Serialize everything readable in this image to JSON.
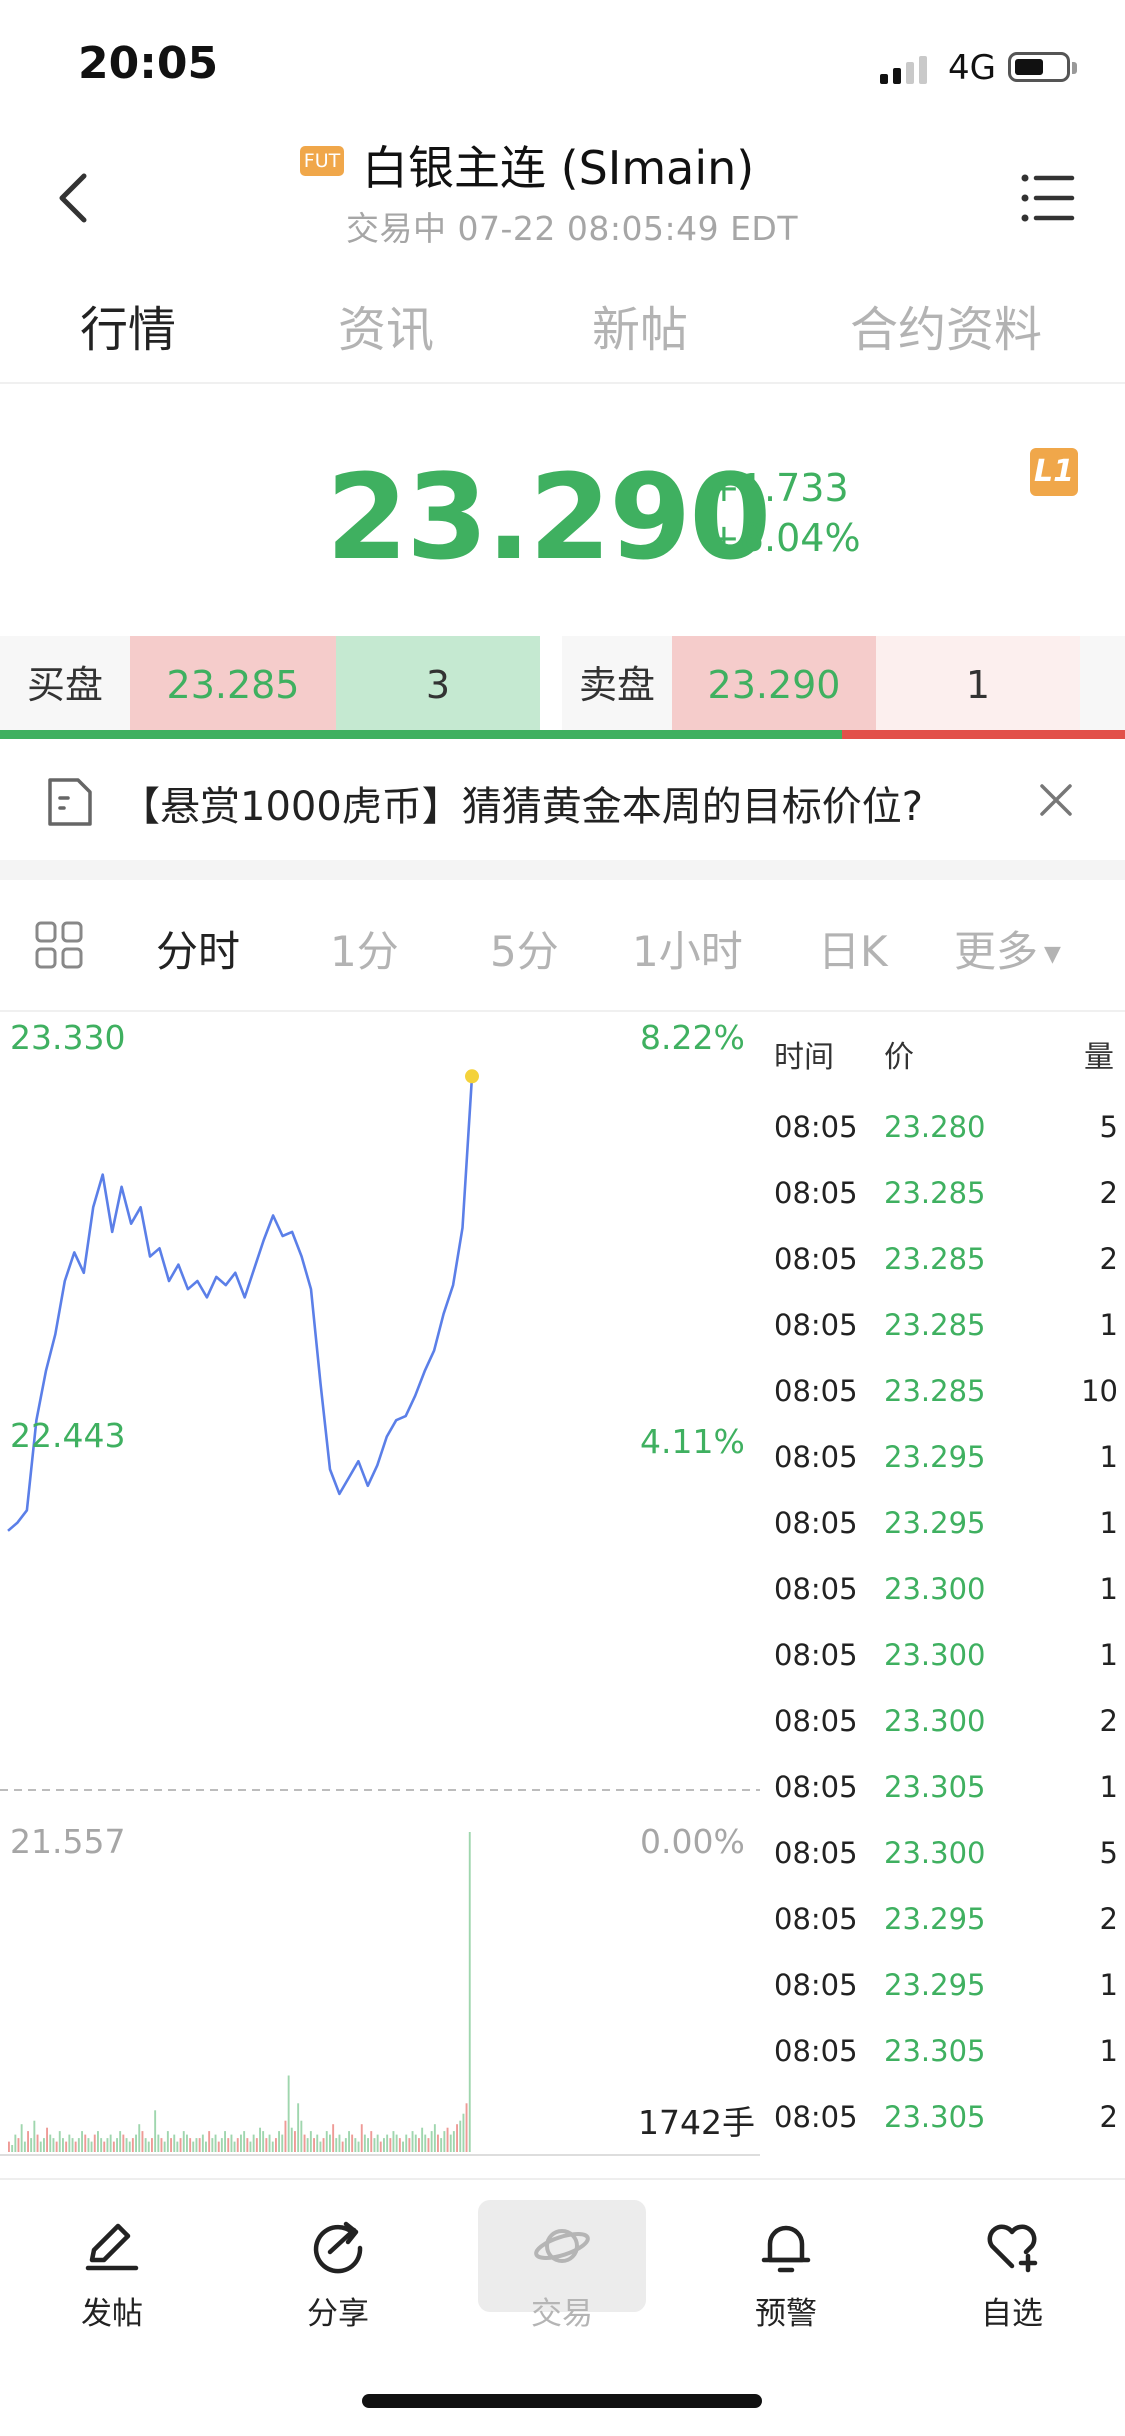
{
  "status_bar": {
    "time": "20:05",
    "network": "4G"
  },
  "header": {
    "badge": "FUT",
    "title": "白银主连 (SImain)",
    "subtitle": "交易中 07-22 08:05:49 EDT"
  },
  "tabs": [
    {
      "label": "行情",
      "active": true
    },
    {
      "label": "资讯",
      "active": false
    },
    {
      "label": "新帖",
      "active": false
    },
    {
      "label": "合约资料",
      "active": false
    }
  ],
  "quote": {
    "price": "23.290",
    "change": "+1.733",
    "change_pct": "+8.04%",
    "level_badge": "L1"
  },
  "order_book": {
    "bid_label": "买盘",
    "bid_price": "23.285",
    "bid_size": "3",
    "ask_label": "卖盘",
    "ask_price": "23.290",
    "ask_size": "1"
  },
  "notice": {
    "text": "【悬赏1000虎币】猜猜黄金本周的目标价位?"
  },
  "periods": [
    {
      "label": "分时",
      "active": true
    },
    {
      "label": "1分",
      "active": false
    },
    {
      "label": "5分",
      "active": false
    },
    {
      "label": "1小时",
      "active": false
    },
    {
      "label": "日K",
      "active": false
    },
    {
      "label": "更多",
      "active": false
    }
  ],
  "chart_data": {
    "type": "line",
    "y_high": "23.330",
    "y_mid": "22.443",
    "y_low": "21.557",
    "pct_high": "8.22%",
    "pct_mid": "4.11%",
    "pct_low": "0.00%",
    "volume_label": "1742手",
    "ylim": [
      21.557,
      23.33
    ],
    "line_points": [
      [
        0,
        22.19
      ],
      [
        3,
        22.21
      ],
      [
        6,
        22.24
      ],
      [
        9,
        22.46
      ],
      [
        12,
        22.58
      ],
      [
        15,
        22.67
      ],
      [
        18,
        22.8
      ],
      [
        21,
        22.87
      ],
      [
        24,
        22.82
      ],
      [
        27,
        22.98
      ],
      [
        30,
        23.06
      ],
      [
        33,
        22.92
      ],
      [
        36,
        23.03
      ],
      [
        39,
        22.94
      ],
      [
        42,
        22.98
      ],
      [
        45,
        22.86
      ],
      [
        48,
        22.88
      ],
      [
        51,
        22.8
      ],
      [
        54,
        22.84
      ],
      [
        57,
        22.78
      ],
      [
        60,
        22.8
      ],
      [
        63,
        22.76
      ],
      [
        66,
        22.81
      ],
      [
        69,
        22.79
      ],
      [
        72,
        22.82
      ],
      [
        75,
        22.76
      ],
      [
        78,
        22.83
      ],
      [
        81,
        22.9
      ],
      [
        84,
        22.96
      ],
      [
        87,
        22.91
      ],
      [
        90,
        22.92
      ],
      [
        93,
        22.86
      ],
      [
        96,
        22.78
      ],
      [
        99,
        22.55
      ],
      [
        102,
        22.34
      ],
      [
        105,
        22.28
      ],
      [
        108,
        22.32
      ],
      [
        111,
        22.36
      ],
      [
        114,
        22.3
      ],
      [
        117,
        22.35
      ],
      [
        120,
        22.42
      ],
      [
        123,
        22.46
      ],
      [
        126,
        22.47
      ],
      [
        129,
        22.52
      ],
      [
        132,
        22.58
      ],
      [
        135,
        22.63
      ],
      [
        138,
        22.72
      ],
      [
        141,
        22.79
      ],
      [
        144,
        22.93
      ],
      [
        147,
        23.3
      ]
    ],
    "volume": [
      3,
      2,
      5,
      4,
      8,
      3,
      6,
      4,
      9,
      5,
      3,
      4,
      7,
      5,
      4,
      3,
      6,
      4,
      3,
      5,
      4,
      3,
      4,
      6,
      5,
      4,
      3,
      5,
      6,
      4,
      3,
      4,
      5,
      3,
      4,
      6,
      5,
      4,
      3,
      4,
      5,
      8,
      6,
      4,
      3,
      4,
      12,
      5,
      4,
      3,
      6,
      4,
      5,
      3,
      4,
      6,
      5,
      4,
      3,
      4,
      4,
      5,
      3,
      6,
      4,
      5,
      3,
      4,
      6,
      4,
      5,
      3,
      4,
      5,
      6,
      4,
      3,
      5,
      4,
      7,
      6,
      4,
      5,
      3,
      4,
      6,
      5,
      9,
      22,
      7,
      6,
      14,
      9,
      5,
      4,
      6,
      4,
      5,
      3,
      4,
      6,
      5,
      8,
      4,
      5,
      3,
      4,
      6,
      5,
      4,
      3,
      8,
      5,
      4,
      6,
      4,
      5,
      3,
      4,
      5,
      4,
      6,
      5,
      4,
      3,
      5,
      4,
      6,
      5,
      4,
      7,
      5,
      4,
      6,
      8,
      5,
      4,
      6,
      7,
      5,
      6,
      8,
      9,
      11,
      14,
      92
    ],
    "ask_dot": true
  },
  "trade_list": {
    "headers": [
      "时间",
      "价",
      "量"
    ],
    "rows": [
      {
        "time": "08:05",
        "price": "23.280",
        "vol": "5"
      },
      {
        "time": "08:05",
        "price": "23.285",
        "vol": "2"
      },
      {
        "time": "08:05",
        "price": "23.285",
        "vol": "2"
      },
      {
        "time": "08:05",
        "price": "23.285",
        "vol": "1"
      },
      {
        "time": "08:05",
        "price": "23.285",
        "vol": "10"
      },
      {
        "time": "08:05",
        "price": "23.295",
        "vol": "1"
      },
      {
        "time": "08:05",
        "price": "23.295",
        "vol": "1"
      },
      {
        "time": "08:05",
        "price": "23.300",
        "vol": "1"
      },
      {
        "time": "08:05",
        "price": "23.300",
        "vol": "1"
      },
      {
        "time": "08:05",
        "price": "23.300",
        "vol": "2"
      },
      {
        "time": "08:05",
        "price": "23.305",
        "vol": "1"
      },
      {
        "time": "08:05",
        "price": "23.300",
        "vol": "5"
      },
      {
        "time": "08:05",
        "price": "23.295",
        "vol": "2"
      },
      {
        "time": "08:05",
        "price": "23.295",
        "vol": "1"
      },
      {
        "time": "08:05",
        "price": "23.305",
        "vol": "1"
      },
      {
        "time": "08:05",
        "price": "23.305",
        "vol": "2"
      }
    ]
  },
  "bottom_nav": [
    {
      "label": "发帖",
      "icon": "pen-icon"
    },
    {
      "label": "分享",
      "icon": "share-icon"
    },
    {
      "label": "交易",
      "icon": "planet-icon"
    },
    {
      "label": "预警",
      "icon": "bell-icon"
    },
    {
      "label": "自选",
      "icon": "heart-plus-icon"
    }
  ],
  "colors": {
    "up": "#3fb060",
    "down": "#e2504a",
    "accent": "#f0a74a",
    "line": "#5b7fe8"
  }
}
